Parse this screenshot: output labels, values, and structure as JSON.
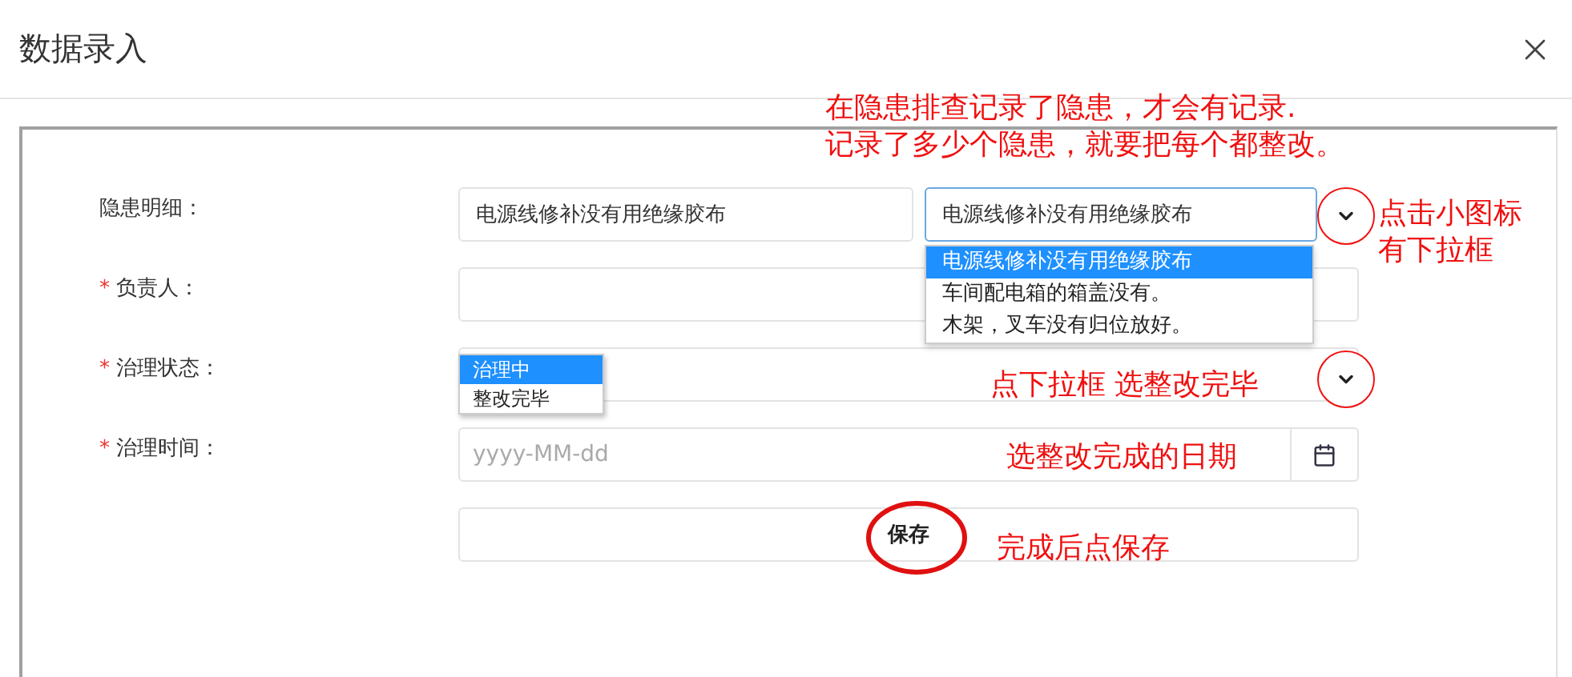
{
  "dialog": {
    "title": "数据录入"
  },
  "required_mark": "*",
  "form": {
    "fields": [
      {
        "kind": "double-select",
        "label": "隐患明细：",
        "required": false,
        "value": "电源线修补没有用绝缘胶布",
        "select_value": "电源线修补没有用绝缘胶布",
        "focused": true,
        "options": [
          {
            "label": "电源线修补没有用绝缘胶布",
            "selected": true
          },
          {
            "label": "车间配电箱的箱盖没有。",
            "selected": false
          },
          {
            "label": "木架，叉车没有归位放好。",
            "selected": false
          }
        ]
      },
      {
        "kind": "text",
        "label": "负责人：",
        "required": true
      },
      {
        "kind": "select",
        "label": "治理状态：",
        "required": true,
        "options": [
          {
            "label": "治理中",
            "selected": true
          },
          {
            "label": "整改完毕",
            "selected": false
          }
        ]
      },
      {
        "kind": "date",
        "label": "治理时间：",
        "required": true,
        "placeholder": "yyyy-MM-dd"
      }
    ],
    "save_button": "保存"
  },
  "annotations": [
    {
      "kind": "text",
      "lines": [
        "在隐患排查记录了隐患，才会有记录.",
        "记录了多少个隐患，就要把每个都整改。"
      ]
    },
    {
      "kind": "circled-chevron"
    },
    {
      "kind": "text",
      "lines": [
        "点击小图标",
        "有下拉框"
      ]
    },
    {
      "kind": "circled-chevron"
    },
    {
      "kind": "text",
      "lines": [
        "点下拉框  选整改完毕"
      ]
    },
    {
      "kind": "text",
      "lines": [
        "选整改完成的日期"
      ]
    },
    {
      "kind": "ellipse"
    },
    {
      "kind": "text",
      "lines": [
        "完成后点保存"
      ]
    }
  ]
}
